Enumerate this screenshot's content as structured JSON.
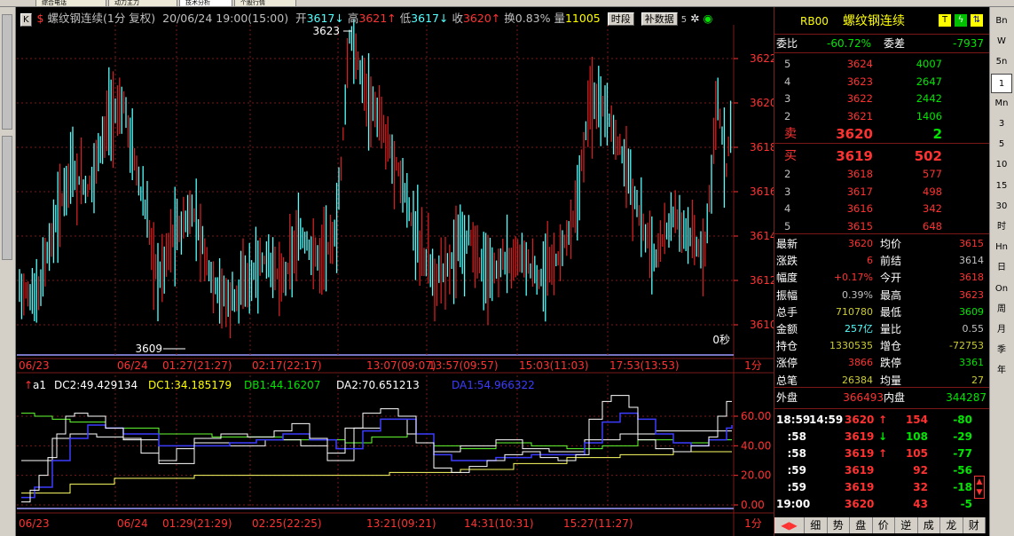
{
  "top_tabs": [
    "综合电话",
    "动力主力",
    "技术分析",
    "个股行情"
  ],
  "title": {
    "k_icon": "K",
    "name": "螺纹钢连续(1分 复权)",
    "datetime": "20/06/24 19:00(15:00)",
    "open_label": "开",
    "open": "3617",
    "high_label": "高",
    "high": "3621",
    "low_label": "低",
    "low": "3617",
    "close_label": "收",
    "close": "3620",
    "turnover_label": "换",
    "turnover": "0.83%",
    "volume_label": "量",
    "volume": "11005",
    "btn_period": "时段",
    "btn_supplement": "补数据",
    "extra": "5"
  },
  "price_axis": [
    "3622",
    "3620",
    "3618",
    "3616",
    "3614",
    "3612",
    "3610"
  ],
  "annotations": {
    "high_mark": "3623",
    "low_mark": "3609",
    "seconds": "0秒"
  },
  "time_axis_top": [
    "06/23",
    "06/24",
    "01:27(21:27)",
    "02:17(22:17)",
    "13:07(09:07)",
    "13:57(09:57)",
    "15:03(11:03)",
    "17:53(13:53)"
  ],
  "time_axis_bottom": [
    "06/23",
    "06/24",
    "01:29(21:29)",
    "02:25(22:25)",
    "13:21(09:21)",
    "14:31(10:31)",
    "15:27(11:27)"
  ],
  "period_label": "1分",
  "indicator": {
    "name": "a1",
    "dc2": "DC2:49.429134",
    "dc1": "DC1:34.185179",
    "db1": "DB1:44.16207",
    "da2": "DA2:70.651213",
    "da1": "DA1:54.966322",
    "axis": [
      "60.00",
      "40.00",
      "20.00",
      "0.00"
    ]
  },
  "panel": {
    "code": "RB00",
    "name": "螺纹钢连续",
    "weibi_label": "委比",
    "weibi": "-60.72%",
    "weicha_label": "委差",
    "weicha": "-7937",
    "asks": [
      {
        "level": "5",
        "price": "3624",
        "vol": "4007"
      },
      {
        "level": "4",
        "price": "3623",
        "vol": "2647"
      },
      {
        "level": "3",
        "price": "3622",
        "vol": "2442"
      },
      {
        "level": "2",
        "price": "3621",
        "vol": "1406"
      },
      {
        "level": "卖",
        "price": "3620",
        "vol": "2"
      }
    ],
    "bids": [
      {
        "level": "买",
        "price": "3619",
        "vol": "502"
      },
      {
        "level": "2",
        "price": "3618",
        "vol": "577"
      },
      {
        "level": "3",
        "price": "3617",
        "vol": "498"
      },
      {
        "level": "4",
        "price": "3616",
        "vol": "342"
      },
      {
        "level": "5",
        "price": "3615",
        "vol": "648"
      }
    ],
    "stats": [
      {
        "l1": "最新",
        "v1": "3620",
        "l2": "均价",
        "v2": "3615",
        "c1": "red",
        "c2": "red"
      },
      {
        "l1": "涨跌",
        "v1": "6",
        "l2": "前结",
        "v2": "3614",
        "c1": "red",
        "c2": "gray"
      },
      {
        "l1": "幅度",
        "v1": "+0.17%",
        "l2": "今开",
        "v2": "3618",
        "c1": "red",
        "c2": "red"
      },
      {
        "l1": "振幅",
        "v1": "0.39%",
        "l2": "最高",
        "v2": "3623",
        "c1": "gray",
        "c2": "red"
      },
      {
        "l1": "总手",
        "v1": "710780",
        "l2": "最低",
        "v2": "3609",
        "c1": "olive",
        "c2": "green"
      },
      {
        "l1": "金额",
        "v1": "257亿",
        "l2": "量比",
        "v2": "0.55",
        "c1": "cyan",
        "c2": "gray"
      },
      {
        "l1": "持仓",
        "v1": "1330535",
        "l2": "增仓",
        "v2": "-72753",
        "c1": "olive",
        "c2": "olive"
      },
      {
        "l1": "涨停",
        "v1": "3866",
        "l2": "跌停",
        "v2": "3361",
        "c1": "red",
        "c2": "green"
      },
      {
        "l1": "总笔",
        "v1": "26384",
        "l2": "均量",
        "v2": "27",
        "c1": "olive",
        "c2": "olive"
      }
    ],
    "outer_label": "外盘",
    "outer": "366493",
    "inner_label": "内盘",
    "inner": "344287",
    "ticks": [
      {
        "time": "18:59",
        "time2": "14:59",
        "price": "3620",
        "dir": "↑",
        "vol": "154",
        "chg": "-80",
        "dc": "red",
        "cc": "green"
      },
      {
        "time": ":58",
        "time2": "",
        "price": "3619",
        "dir": "↓",
        "vol": "108",
        "chg": "-29",
        "dc": "green",
        "cc": "green"
      },
      {
        "time": ":58",
        "time2": "",
        "price": "3619",
        "dir": "↑",
        "vol": "105",
        "chg": "-77",
        "dc": "red",
        "cc": "green"
      },
      {
        "time": ":59",
        "time2": "",
        "price": "3619",
        "dir": "",
        "vol": "92",
        "chg": "-56",
        "dc": "red",
        "cc": "green"
      },
      {
        "time": ":59",
        "time2": "",
        "price": "3619",
        "dir": "",
        "vol": "32",
        "chg": "-18",
        "dc": "red",
        "cc": "green"
      },
      {
        "time": "19:00",
        "time2": "",
        "price": "3620",
        "dir": "",
        "vol": "43",
        "chg": "-5",
        "dc": "red",
        "cc": "green"
      }
    ],
    "bottom_tabs": [
      "细",
      "势",
      "盘",
      "价",
      "逆",
      "成",
      "龙",
      "财"
    ]
  },
  "side_buttons": [
    "Bn",
    "W",
    "5n",
    "1",
    "Mn",
    "3",
    "5",
    "10",
    "15",
    "30",
    "时",
    "Hn",
    "日",
    "On",
    "周",
    "月",
    "季",
    "年"
  ],
  "colors": {
    "up": "#ff3232",
    "down": "#54ffff",
    "grid": "#7a1818",
    "bg": "#000000"
  }
}
